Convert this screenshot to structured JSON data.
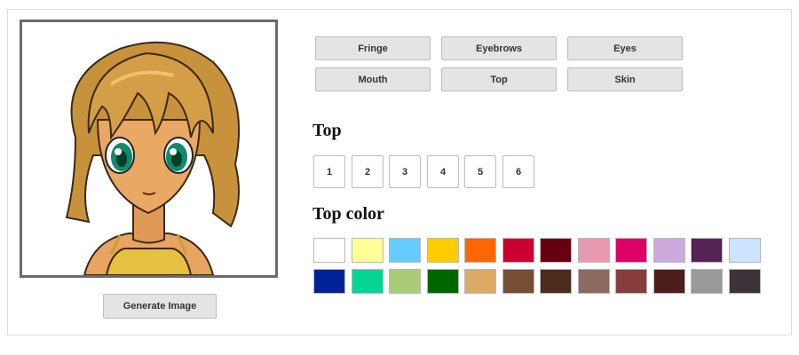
{
  "generate_label": "Generate Image",
  "categories": [
    {
      "label": "Fringe"
    },
    {
      "label": "Eyebrows"
    },
    {
      "label": "Eyes"
    },
    {
      "label": "Mouth"
    },
    {
      "label": "Top"
    },
    {
      "label": "Skin"
    }
  ],
  "style_section": {
    "heading": "Top",
    "options": [
      "1",
      "2",
      "3",
      "4",
      "5",
      "6"
    ]
  },
  "color_section": {
    "heading": "Top color",
    "swatches": [
      "#ffffff",
      "#ffff99",
      "#66ccff",
      "#ffcc00",
      "#ff6600",
      "#cc0033",
      "#660011",
      "#e899b0",
      "#dd0066",
      "#ccaadd",
      "#552255",
      "#cce4ff",
      "#002299",
      "#00d594",
      "#aacc77",
      "#006600",
      "#ddaa66",
      "#774d33",
      "#4d2b1d",
      "#8c6a60",
      "#883c3c",
      "#4d1c1c",
      "#999999",
      "#3c3338"
    ]
  }
}
